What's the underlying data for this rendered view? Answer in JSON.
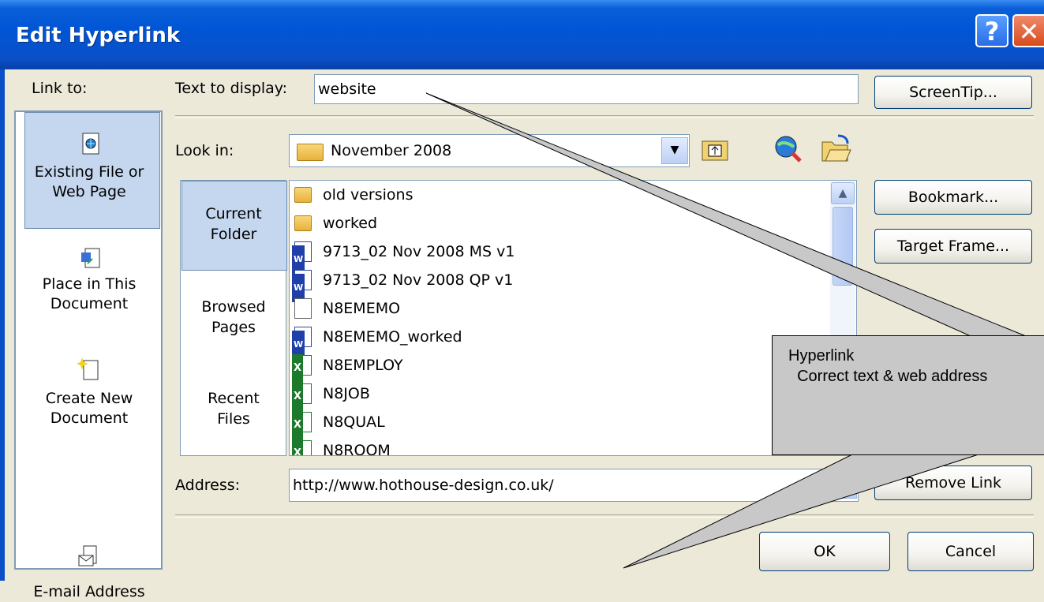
{
  "window": {
    "title": "Edit Hyperlink",
    "help_label": "?",
    "close_label": "✕"
  },
  "sidebar": {
    "heading": "Link to:",
    "items": [
      {
        "line1": "Existing File or",
        "line2": "Web Page",
        "icon": "web-page-icon"
      },
      {
        "line1": "Place in This",
        "line2": "Document",
        "icon": "document-place-icon"
      },
      {
        "line1": "Create New",
        "line2": "Document",
        "icon": "new-document-icon"
      },
      {
        "line1": "E-mail Address",
        "line2": "",
        "icon": "email-icon"
      }
    ]
  },
  "text_to_display": {
    "label": "Text to display:",
    "value": "website"
  },
  "buttons": {
    "screentip": "ScreenTip...",
    "bookmark": "Bookmark...",
    "target_frame": "Target Frame...",
    "remove_link": "Remove Link",
    "ok": "OK",
    "cancel": "Cancel"
  },
  "look_in": {
    "label": "Look in:",
    "value": "November 2008"
  },
  "nav": [
    {
      "line1": "Current",
      "line2": "Folder"
    },
    {
      "line1": "Browsed",
      "line2": "Pages"
    },
    {
      "line1": "Recent",
      "line2": "Files"
    }
  ],
  "files": [
    {
      "name": "old versions",
      "type": "folder"
    },
    {
      "name": "worked",
      "type": "folder"
    },
    {
      "name": "9713_02 Nov 2008 MS v1",
      "type": "word"
    },
    {
      "name": "9713_02 Nov 2008 QP v1",
      "type": "word"
    },
    {
      "name": "N8EMEMO",
      "type": "text"
    },
    {
      "name": "N8EMEMO_worked",
      "type": "word"
    },
    {
      "name": "N8EMPLOY",
      "type": "excel"
    },
    {
      "name": "N8JOB",
      "type": "excel"
    },
    {
      "name": "N8QUAL",
      "type": "excel"
    },
    {
      "name": "N8ROOM",
      "type": "excel"
    }
  ],
  "address": {
    "label": "Address:",
    "value": "http://www.hothouse-design.co.uk/"
  },
  "callout": {
    "line1": "Hyperlink",
    "line2": "  Correct text & web address"
  },
  "colors": {
    "titlebar": "#0056d6",
    "dialog_bg": "#ece9d8",
    "selection": "#c5d7ef",
    "callout": "#c8c8c8"
  }
}
